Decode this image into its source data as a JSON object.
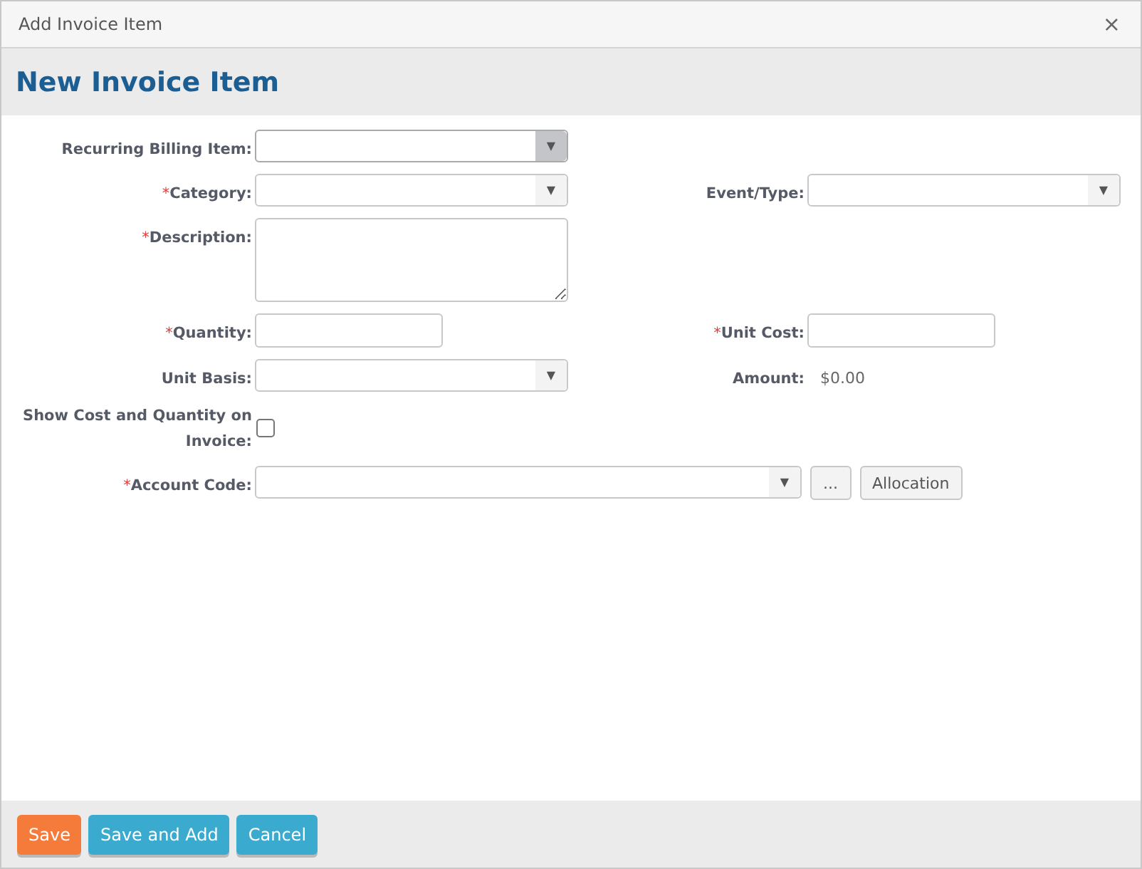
{
  "window": {
    "title": "Add Invoice Item",
    "close": "×"
  },
  "header": {
    "title": "New Invoice Item"
  },
  "rows": [
    {
      "left": {
        "label": "Recurring Billing Item:",
        "kind": "select",
        "focused": true,
        "arrow": "▼"
      }
    },
    {
      "left": {
        "label": "Category:",
        "required": "*",
        "kind": "select",
        "focused": false,
        "arrow": "▼"
      },
      "right": {
        "label": "Event/Type:",
        "kind": "select",
        "focused": false,
        "arrow": "▼"
      }
    },
    {
      "left": {
        "label": "Description:",
        "required": "*",
        "kind": "textarea",
        "focused": false
      }
    },
    {
      "left": {
        "label": "Quantity:",
        "required": "*",
        "kind": "text",
        "focused": false
      },
      "right": {
        "label": "Unit Cost:",
        "required": "*",
        "kind": "text",
        "focused": false
      }
    },
    {
      "left": {
        "label": "Unit Basis:",
        "kind": "select",
        "focused": false,
        "arrow": "▼"
      },
      "right": {
        "label": "Amount:",
        "kind": "value",
        "value": "$0.00"
      }
    },
    {
      "left": {
        "label": "Show Cost and Quantity on Invoice:",
        "kind": "checkbox",
        "checked": false
      }
    },
    {
      "left": {
        "label": "Account Code:",
        "required": "*",
        "kind": "wide-select",
        "focused": false,
        "arrow": "▼",
        "buttons": [
          "...",
          "Allocation"
        ]
      }
    }
  ],
  "footer": {
    "buttons": [
      {
        "label": "Save",
        "kind": "primary"
      },
      {
        "label": "Save and Add",
        "kind": "secondary"
      },
      {
        "label": "Cancel",
        "kind": "secondary"
      }
    ]
  }
}
